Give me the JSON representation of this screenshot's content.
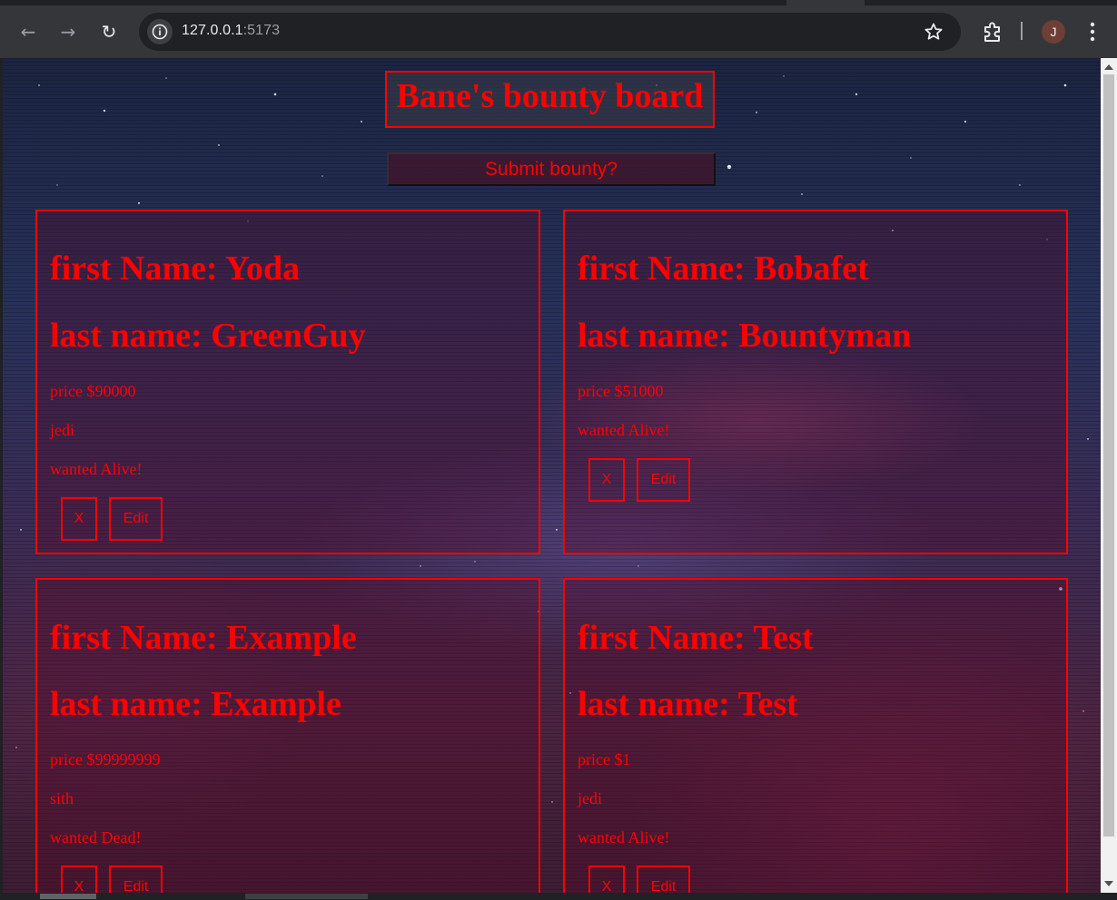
{
  "browser": {
    "url_host": "127.0.0.1",
    "url_port": ":5173",
    "profile_initial": "J"
  },
  "page": {
    "title": "Bane's bounty board",
    "submit_label": "Submit bounty?"
  },
  "cards": [
    {
      "first": "first Name: Yoda",
      "last": "last name: GreenGuy",
      "price": "price $90000",
      "side": "jedi",
      "wanted": "wanted Alive!",
      "delete_label": "X",
      "edit_label": "Edit"
    },
    {
      "first": "first Name: Bobafet",
      "last": "last name: Bountyman",
      "price": "price $51000",
      "wanted": "wanted Alive!",
      "delete_label": "X",
      "edit_label": "Edit"
    },
    {
      "first": "first Name: Example",
      "last": "last name: Example",
      "price": "price $99999999",
      "side": "sith",
      "wanted": "wanted Dead!",
      "delete_label": "X",
      "edit_label": "Edit"
    },
    {
      "first": "first Name: Test",
      "last": "last name: Test",
      "price": "price $1",
      "side": "jedi",
      "wanted": "wanted Alive!",
      "delete_label": "X",
      "edit_label": "Edit"
    }
  ],
  "colors": {
    "accent": "#ff0000",
    "chrome": "#35363a"
  }
}
